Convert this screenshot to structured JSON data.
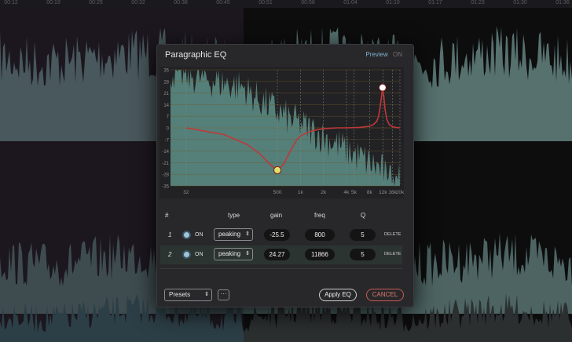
{
  "ruler": {
    "ticks": [
      "00:12",
      "00:19",
      "00:25",
      "00:32",
      "00:38",
      "00:45",
      "00:51",
      "00:58",
      "01:04",
      "01:10",
      "01:17",
      "01:23",
      "01:30",
      "01:36"
    ]
  },
  "dialog": {
    "title": "Paragraphic EQ",
    "preview_label": "Preview",
    "preview_state": "ON"
  },
  "chart_data": {
    "type": "line",
    "title": "",
    "xlabel": "",
    "ylabel": "",
    "x_scale": "log",
    "x_tick_labels": [
      "32",
      "500",
      "1k",
      "2k",
      "4k",
      "5k",
      "8k",
      "12k",
      "16k",
      "20k"
    ],
    "x_tick_values": [
      32,
      500,
      1000,
      2000,
      4000,
      5000,
      8000,
      12000,
      16000,
      20000
    ],
    "y_tick_labels": [
      "35",
      "28",
      "21",
      "14",
      "7",
      "0",
      "-7",
      "-14",
      "-21",
      "-28",
      "-35"
    ],
    "ylim": [
      -35,
      35
    ],
    "grid": true,
    "series": [
      {
        "type": "line",
        "color": "#c0383a",
        "x": [
          32,
          100,
          200,
          300,
          400,
          500,
          600,
          700,
          800,
          900,
          1000,
          1200,
          1500,
          2000,
          3000,
          4000,
          6000,
          8000,
          9000,
          10000,
          10500,
          11000,
          11500,
          11866,
          12300,
          12800,
          13500,
          14500,
          16000,
          18000,
          20000
        ],
        "y": [
          0,
          -4,
          -10,
          -16,
          -22,
          -25.5,
          -22,
          -16,
          -11,
          -7,
          -5,
          -3,
          -1.5,
          -0.5,
          0,
          0,
          0.3,
          1,
          2,
          4,
          7,
          12,
          19,
          24.27,
          19,
          11,
          5,
          2,
          0.7,
          0.2,
          0
        ]
      }
    ],
    "handles": [
      {
        "x": 500,
        "y": -25.5,
        "color": "#e2e06a"
      },
      {
        "x": 11866,
        "y": 24.27,
        "color": "#ffffff"
      }
    ]
  },
  "bands_header": {
    "num": "#",
    "type": "type",
    "gain": "gain",
    "freq": "freq",
    "q": "Q"
  },
  "bands": [
    {
      "num": "1",
      "on_label": "ON",
      "type": "peaking",
      "gain": "-25.5",
      "freq": "800",
      "q": "5",
      "delete_label": "DELETE"
    },
    {
      "num": "2",
      "on_label": "ON",
      "type": "peaking",
      "gain": "24.27",
      "freq": "11866",
      "q": "5",
      "delete_label": "DELETE"
    }
  ],
  "footer": {
    "presets_label": "Presets",
    "more_label": "···",
    "apply_label": "Apply EQ",
    "cancel_label": "CANCEL"
  },
  "icons": {
    "select_arrow": "up-down-arrow-icon",
    "toggle": "toggle-dot-icon"
  },
  "colors": {
    "accent": "#7fb0cf",
    "curve": "#c0383a",
    "spectrum": "#5e8f88",
    "cancel": "#e07770"
  }
}
